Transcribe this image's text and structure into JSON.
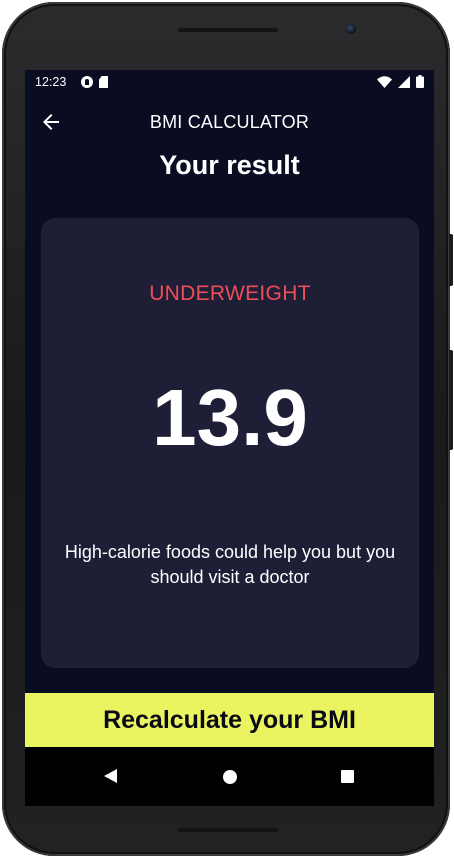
{
  "status_bar": {
    "time": "12:23"
  },
  "app_bar": {
    "title": "BMI CALCULATOR"
  },
  "page": {
    "title": "Your result"
  },
  "result": {
    "status": "UNDERWEIGHT",
    "value": "13.9",
    "advice": "High-calorie foods could help you but you should visit a doctor"
  },
  "actions": {
    "recalculate_label": "Recalculate your BMI"
  },
  "colors": {
    "background": "#0a0c22",
    "card": "#1e1f37",
    "status_underweight": "#ef4d58",
    "accent_button": "#eaf461"
  },
  "icons": {
    "back": "arrow-left-icon",
    "nav_back": "triangle-back-icon",
    "nav_home": "circle-home-icon",
    "nav_recents": "square-recents-icon",
    "wifi": "wifi-icon",
    "signal": "signal-icon",
    "battery": "battery-icon"
  }
}
